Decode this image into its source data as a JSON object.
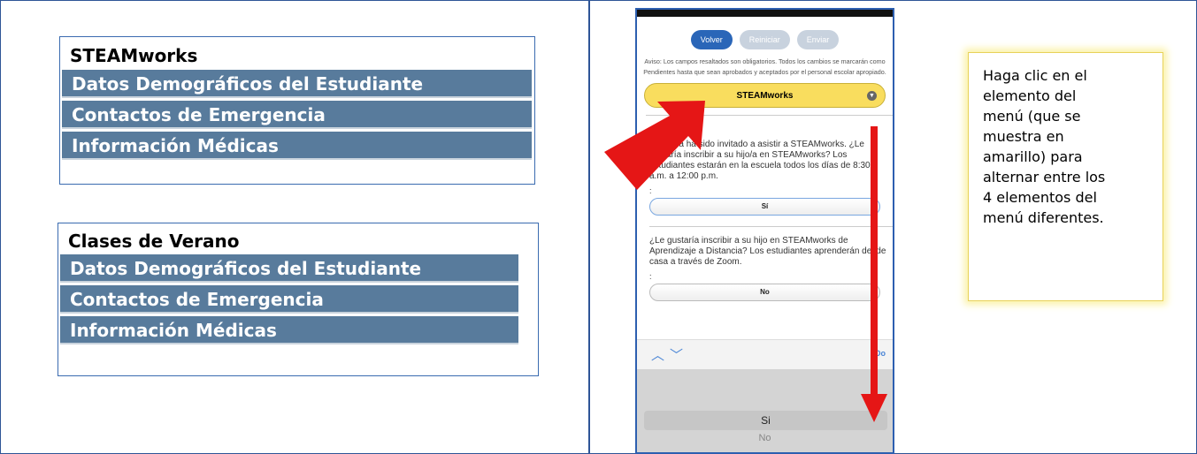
{
  "menus": [
    {
      "title": "STEAMworks",
      "items": [
        "Datos Demográficos del Estudiante",
        "Contactos de Emergencia",
        "Información Médicas"
      ]
    },
    {
      "title": "Clases de Verano",
      "items": [
        "Datos Demográficos del Estudiante",
        "Contactos de Emergencia",
        "Información Médicas"
      ]
    }
  ],
  "phone": {
    "buttons": {
      "back": "Volver",
      "reset": "Reiniciar",
      "send": "Enviar"
    },
    "notice": "Aviso: Los campos resaltados son obligatorios. Todos los cambios se marcarán como Pendientes hasta que sean aprobados y aceptados por el personal escolar apropiado.",
    "selector_label": "STEAMworks",
    "section_fragment": "ks",
    "q1": "Su hijo/a ha sido invitado a asistir a STEAMworks. ¿Le gustaría inscribir a su hijo/a en STEAMworks? Los estudiantes estarán en la escuela todos los días de 8:30 a.m. a 12:00 p.m.",
    "q1_colon": ":",
    "q1_answer": "Sí",
    "q2": "¿Le gustaría inscribir a su hijo en STEAMworks de Aprendizaje a Distancia? Los estudiantes aprenderán desde casa a través de Zoom.",
    "q2_colon": ":",
    "q2_answer": "No",
    "done_label": "Do",
    "picker_selected": "Si",
    "picker_next": "No",
    "colors": {
      "accent": "#2a66b8",
      "selector": "#f9dd5e",
      "arrow": "#e51616"
    }
  },
  "callout": {
    "text": "Haga clic en el elemento del menú (que se muestra en amarillo) para alternar entre los 4 elementos del menú diferentes."
  },
  "colors": {
    "menu_item_bg": "#587b9c",
    "border": "#2e5597"
  }
}
